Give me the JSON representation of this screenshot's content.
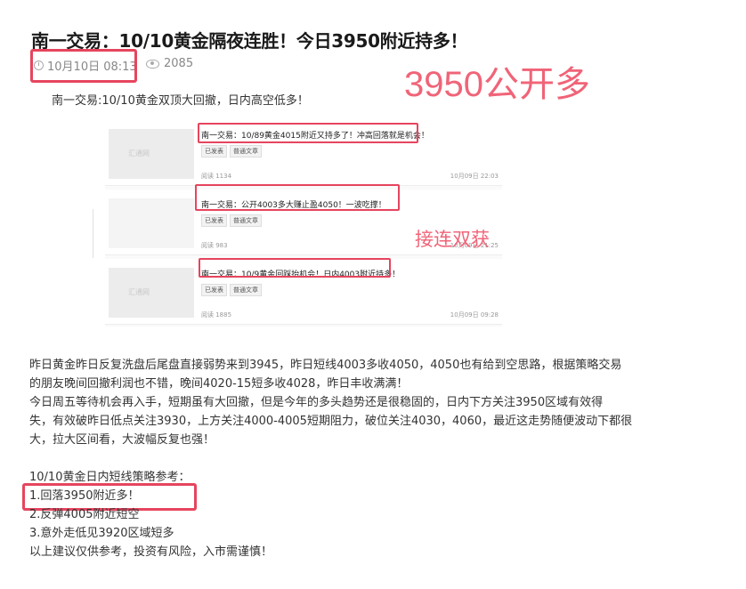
{
  "article": {
    "title": "南一交易：10/10黄金隔夜连胜！今日3950附近持多！",
    "date": "10月10日 08:13",
    "views": "2085",
    "intro": "南一交易:10/10黄金双顶大回撤，日内高空低多！"
  },
  "annotations": {
    "headline_note": "3950公开多",
    "cards_note": "接连双获"
  },
  "cards": [
    {
      "title": "南一交易：10/89黄金4015附近又持多了！冲高回落就是机会！",
      "tags": [
        "已发表",
        "普通文章"
      ],
      "stat": "阅读 1134",
      "date": "10月09日 22:03",
      "thumb": "汇通网"
    },
    {
      "title": "南一交易：公开4003多大赚止盈4050！一波吃撑！",
      "tags": [
        "已发表",
        "普通文章"
      ],
      "stat": "阅读 983",
      "date": "10月09日 21:25",
      "thumb": ""
    },
    {
      "title": "南一交易：10/9黄金回踩抬机会！日内4003附近持多！",
      "tags": [
        "已发表",
        "普通文章"
      ],
      "stat": "阅读 1885",
      "date": "10月09日 09:28",
      "thumb": "汇通网"
    }
  ],
  "body": {
    "lines": [
      "昨日黄金昨日反复洗盘后尾盘直接弱势来到3945，昨日短线4003多收4050，4050也有给到空思路，根据策略交易",
      "的朋友晚间回撤利润也不错，晚间4020-15短多收4028，昨日丰收满满！",
      "今日周五等待机会再入手，短期虽有大回撤，但是今年的多头趋势还是很稳固的，日内下方关注3950区域有效得",
      "失，有效破昨日低点关注3930，上方关注4000-4005短期阻力，破位关注4030，4060，最近这走势随便波动下都很",
      "大，拉大区间看，大波幅反复也强！"
    ],
    "strategy_title": "10/10黄金日内短线策略参考：",
    "strategies": [
      "1.回落3950附近多！",
      "2.反弹4005附近短空",
      "3.意外走低见3920区域短多"
    ],
    "disclaimer": "以上建议仅供参考，投资有风险，入市需谨慎！"
  }
}
